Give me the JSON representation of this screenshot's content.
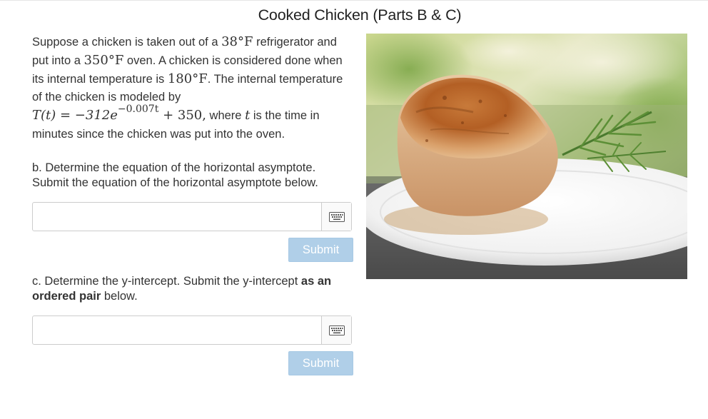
{
  "title": "Cooked Chicken (Parts B & C)",
  "problem": {
    "intro": "Suppose a chicken is taken out of a ",
    "fridge_temp": "38°F",
    "text2": " refrigerator and put into a ",
    "oven_temp": "350°F",
    "text3": " oven. A chicken is considered done when its internal temperature is ",
    "done_temp": "180°F",
    "text4": ". The internal temperature of the chicken is modeled by",
    "formula_lhs": "T(t) = −312e",
    "formula_exp": "−0.007t",
    "formula_rhs": " + 350,",
    "text5": " where ",
    "var_t": "t",
    "text6": " is the time in minutes since the chicken was put into the oven."
  },
  "part_b": {
    "question": "b. Determine the equation of the horizontal asymptote. Submit the equation of the horizontal asymptote below.",
    "input_value": "",
    "submit_label": "Submit"
  },
  "part_c": {
    "question_start": "c. Determine the y-intercept. Submit the y-intercept ",
    "question_bold": "as an ordered pair",
    "question_end": " below.",
    "input_value": "",
    "submit_label": "Submit"
  },
  "icons": {
    "keyboard": "keyboard-icon",
    "image": "cooked-chicken-photo"
  },
  "colors": {
    "submit_disabled": "#b0cfe8",
    "text": "#333333",
    "border": "#cccccc"
  }
}
